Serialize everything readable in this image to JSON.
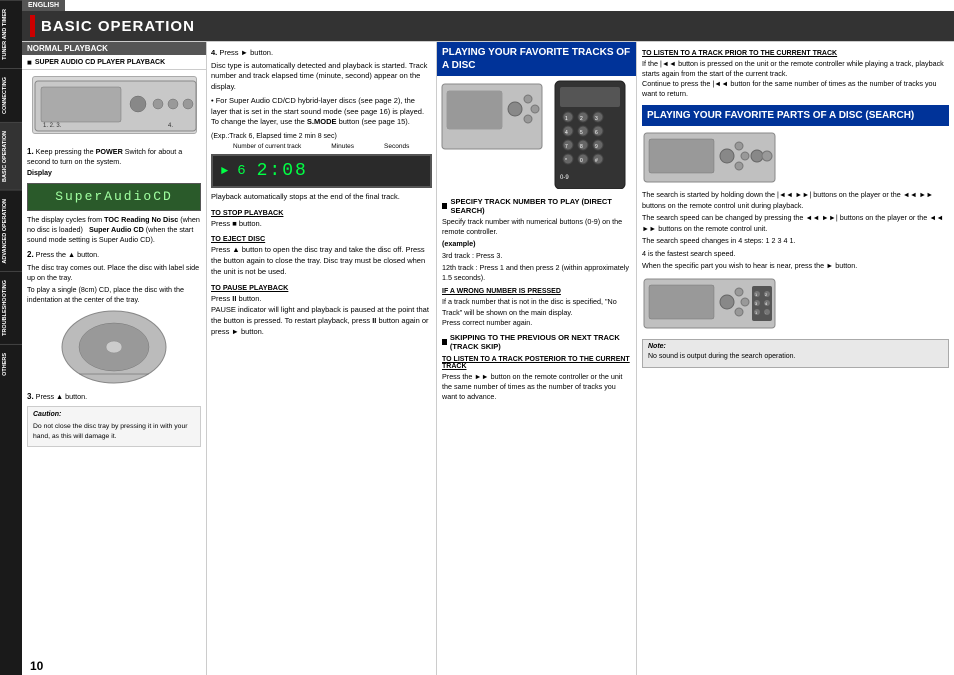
{
  "language_bar": "ENGLISH",
  "page_title": "BASIC OPERATION",
  "page_number": "10",
  "sidebar_tabs": [
    {
      "label": "TUNER AND TIMER",
      "active": false
    },
    {
      "label": "CONNECTING",
      "active": false
    },
    {
      "label": "BASIC OPERATION",
      "active": true
    },
    {
      "label": "ADVANCED OPERATION",
      "active": false
    },
    {
      "label": "TROUBLESHOOTING",
      "active": false
    },
    {
      "label": "OTHERS",
      "active": false
    }
  ],
  "col1": {
    "section_title": "NORMAL PLAYBACK",
    "subsection_title": "SUPER AUDIO CD PLAYER PLAYBACK",
    "diagram_labels": "1.  2.  3.                    4.",
    "steps": [
      {
        "num": "1.",
        "text": "Keep pressing the POWER Switch for about a second to turn on the system.",
        "display_label": "Display",
        "display_text": "SuperAudioCD"
      },
      {
        "num": "",
        "text": "The display cycles from TOC Reading No Disc (when no disc is loaded)  Super Audio CD (when the start sound mode setting is Super Audio CD)."
      },
      {
        "num": "2.",
        "text": "Press the ▲ button.",
        "detail": "The disc tray comes out. Place the disc with label side up on the tray.\nTo play a single (8cm) CD, place the disc with the indentation at the center of the tray."
      },
      {
        "num": "3.",
        "text": "Press ▲ button.",
        "caution_title": "Caution:",
        "caution_text": "Do not close the disc tray by pressing it in with your hand, as this will damage it."
      }
    ]
  },
  "col2": {
    "step4_title": "4.",
    "step4_text": "Press ► button.",
    "step4_detail": "Disc type is automatically detected and playback is started. Track number and track elapsed time (minute, second) appear on the display.",
    "step4_bullet": "For Super Audio CD/CD hybrid-layer discs (see page 2), the layer that is set in the start sound mode (see page 16) is played. To change the layer, use the S.MODE button (see page 15).",
    "exp_label": "(Exp.:Track 6, Elapsed time 2 min 8 sec)",
    "track_display": {
      "header_left": "Number of current track",
      "header_mid": "Minutes",
      "header_right": "Seconds",
      "play_symbol": "►",
      "track_num": "6",
      "time": "2:08"
    },
    "playback_stops_text": "Playback automatically stops at the end of the final track.",
    "to_stop_playback": {
      "label": "TO STOP PLAYBACK",
      "text": "Press ■ button."
    },
    "to_eject_disc": {
      "label": "TO EJECT DISC",
      "text": "Press ▲ button to open the disc tray and take the disc off. Press the button again to close the tray. Disc tray must be closed when the unit is not be used."
    },
    "to_pause_playback": {
      "label": "TO PAUSE PLAYBACK",
      "text": "Press II button.\nPAUSE indicator will light and playback is paused at the point that the button is pressed. To restart playback, press II button again or press ► button."
    }
  },
  "col3": {
    "section_title": "PLAYING YOUR FAVORITE TRACKS OF A DISC",
    "specify_title": "SPECIFY TRACK NUMBER TO PLAY (DIRECT SEARCH)",
    "specify_text": "Specify track number with numerical buttons (0-9) on the remote controller.",
    "example_label": "(example)",
    "example_3rd": "3rd track  :  Press 3.",
    "example_12th": "12th track :  Press 1 and then press 2 (within approximately 1.5 seconds).",
    "wrong_number_title": "IF A WRONG NUMBER IS PRESSED",
    "wrong_number_text": "If a track number that is not in the disc is specified, \"No Track\" will be shown on the main display.\nPress correct number again.",
    "skipping_title": "SKIPPING TO THE PREVIOUS OR NEXT TRACK (TRACK SKIP)",
    "to_listen_posterior_title": "TO LISTEN TO A TRACK POSTERIOR TO THE CURRENT TRACK",
    "to_listen_posterior_text": "Press the ►► button on the remote controller or the unit the same number of times as the number of tracks you want to advance.",
    "nums_label": "0-9"
  },
  "col4": {
    "to_listen_prior_title": "TO LISTEN TO A TRACK PRIOR TO THE CURRENT TRACK",
    "to_listen_prior_text": "If the |◄◄ button is pressed on the unit or the remote controller while playing a track, playback starts again from the start of the current track.\nContinue to press the |◄◄ button for the same number of times as the number of tracks you want to return.",
    "playing_fav_parts_title": "PLAYING YOUR FAVORITE PARTS OF A DISC (SEARCH)",
    "search_text": "The search is started by holding down the |◄◄ ►►| buttons on the player or the  ◄◄  ►► buttons on the remote control unit during playback.\nThe search speed can be changed by pressing the ◄◄ ►►| buttons on the player or the  ◄◄ ►► buttons on the remote control unit.\nThe search speed changes in 4 steps: 1   2   3   4   1.\n4 is the fastest search speed.\nWhen the specific part you wish to hear is near, press the ► button.",
    "note_title": "Note:",
    "note_text": "No sound is output during the search operation."
  }
}
